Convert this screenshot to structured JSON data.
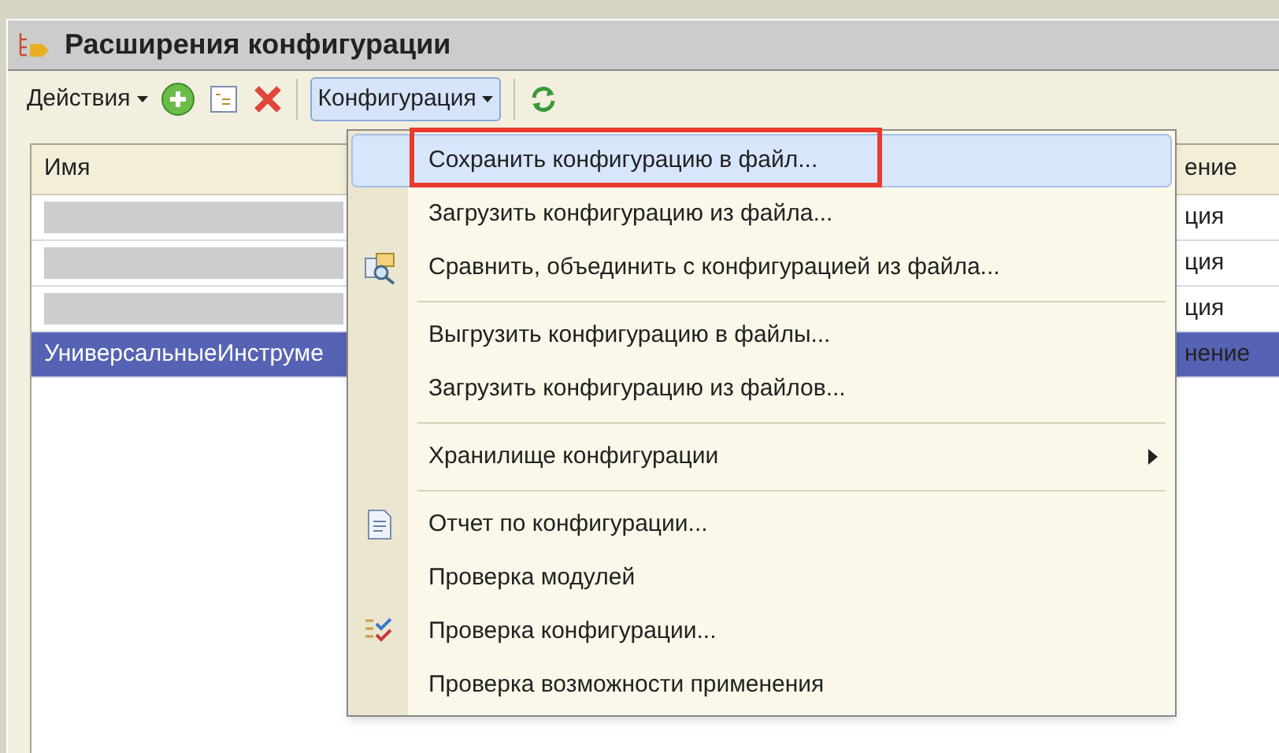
{
  "window": {
    "title": "Расширения конфигурации"
  },
  "toolbar": {
    "actions_label": "Действия",
    "menu_label": "Конфигурация",
    "menu_open": true
  },
  "table": {
    "columns": [
      "Имя",
      "ение"
    ],
    "rows": [
      {
        "name": "",
        "redacted": true,
        "column_2": "ция",
        "selected": false
      },
      {
        "name": "",
        "redacted": true,
        "column_2": "ция",
        "selected": false
      },
      {
        "name": "",
        "redacted": true,
        "column_2": "ция",
        "selected": false
      },
      {
        "name": "УниверсальныеИнструме",
        "redacted": false,
        "column_2": "нение",
        "selected": true
      }
    ]
  },
  "menu": {
    "items": [
      {
        "kind": "item",
        "label": "Сохранить конфигурацию в файл...",
        "selected": true,
        "marked": true
      },
      {
        "kind": "item",
        "label": "Загрузить конфигурацию из файла...",
        "selected": false,
        "marked": false
      },
      {
        "kind": "item",
        "label": "Сравнить, объединить с конфигурацией из файла...",
        "selected": false,
        "marked": false
      },
      {
        "kind": "separator"
      },
      {
        "kind": "item",
        "label": "Выгрузить конфигурацию в файлы...",
        "selected": false,
        "marked": false
      },
      {
        "kind": "item",
        "label": "Загрузить конфигурацию из файлов...",
        "selected": false,
        "marked": false
      },
      {
        "kind": "separator"
      },
      {
        "kind": "submenu",
        "label": "Хранилище конфигурации",
        "selected": false,
        "marked": false
      },
      {
        "kind": "separator"
      },
      {
        "kind": "item",
        "label": "Отчет по конфигурации...",
        "selected": false,
        "marked": false
      },
      {
        "kind": "item",
        "label": "Проверка модулей",
        "selected": false,
        "marked": false
      },
      {
        "kind": "item",
        "label": "Проверка конфигурации...",
        "selected": false,
        "marked": false
      },
      {
        "kind": "item",
        "label": "Проверка возможности применения",
        "selected": false,
        "marked": false
      }
    ]
  }
}
